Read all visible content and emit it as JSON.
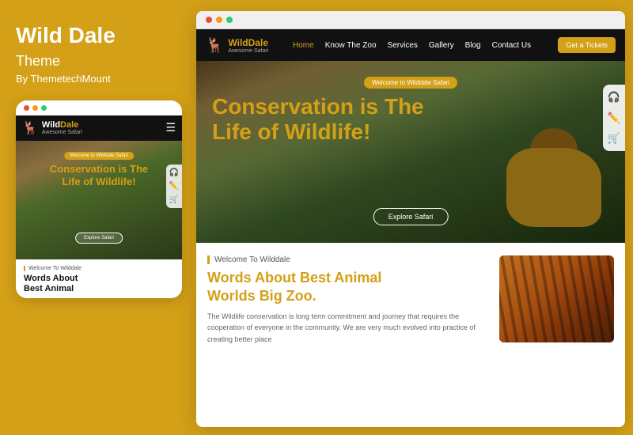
{
  "left": {
    "title": "Wild Dale",
    "subtitle": "Theme",
    "author": "By ThemetechMount",
    "mobile_dots": [
      "#e74c3c",
      "#f39c12",
      "#2ecc71"
    ],
    "mobile_nav": {
      "logo_wild": "Wild",
      "logo_dale": "Dale",
      "logo_sub": "Awesome Safari",
      "logo_icon": "🦌"
    },
    "mobile_hero": {
      "badge": "Welcome to Wilddale Safari",
      "title_line1": "Conservation is The",
      "title_line2": "Life of",
      "title_wild": "Wildlife!",
      "explore": "Explore Safari"
    },
    "mobile_bottom": {
      "welcome_label": "Welcome To Wilddale",
      "title_line1": "Words About",
      "title_line2": "Best Animal"
    },
    "sidebar_icons": [
      "🎧",
      "✏️",
      "🛒"
    ]
  },
  "browser": {
    "dots": [
      "#e74c3c",
      "#f39c12",
      "#2ecc71"
    ],
    "nav": {
      "logo_wild": "Wild",
      "logo_dale": "Dale",
      "logo_sub": "Awesome Safari",
      "logo_icon": "🦌",
      "links": [
        "Home",
        "Know The Zoo",
        "Services",
        "Gallery",
        "Blog",
        "Contact Us"
      ],
      "active_link": "Home",
      "ticket_btn": "Get a Tickets"
    },
    "hero": {
      "badge": "Welcome to Wilddale Safari",
      "title_line1": "Conservation is The",
      "title_line2": "Life of",
      "title_wild": "Wildlife!",
      "explore_btn": "Explore Safari"
    },
    "content": {
      "welcome_label": "Welcome To Wilddale",
      "title_line1": "Words About Best Animal",
      "title_line2": "Worlds",
      "title_highlight": "Big Zoo.",
      "description": "The Wildlife conservation is long term commitment and journey that requires the cooperation of everyone in the community. We are very much evolved into practice of creating better place"
    },
    "sidebar_icons": [
      "🎧",
      "✏️",
      "🛒"
    ]
  },
  "accent_color": "#D4A017"
}
